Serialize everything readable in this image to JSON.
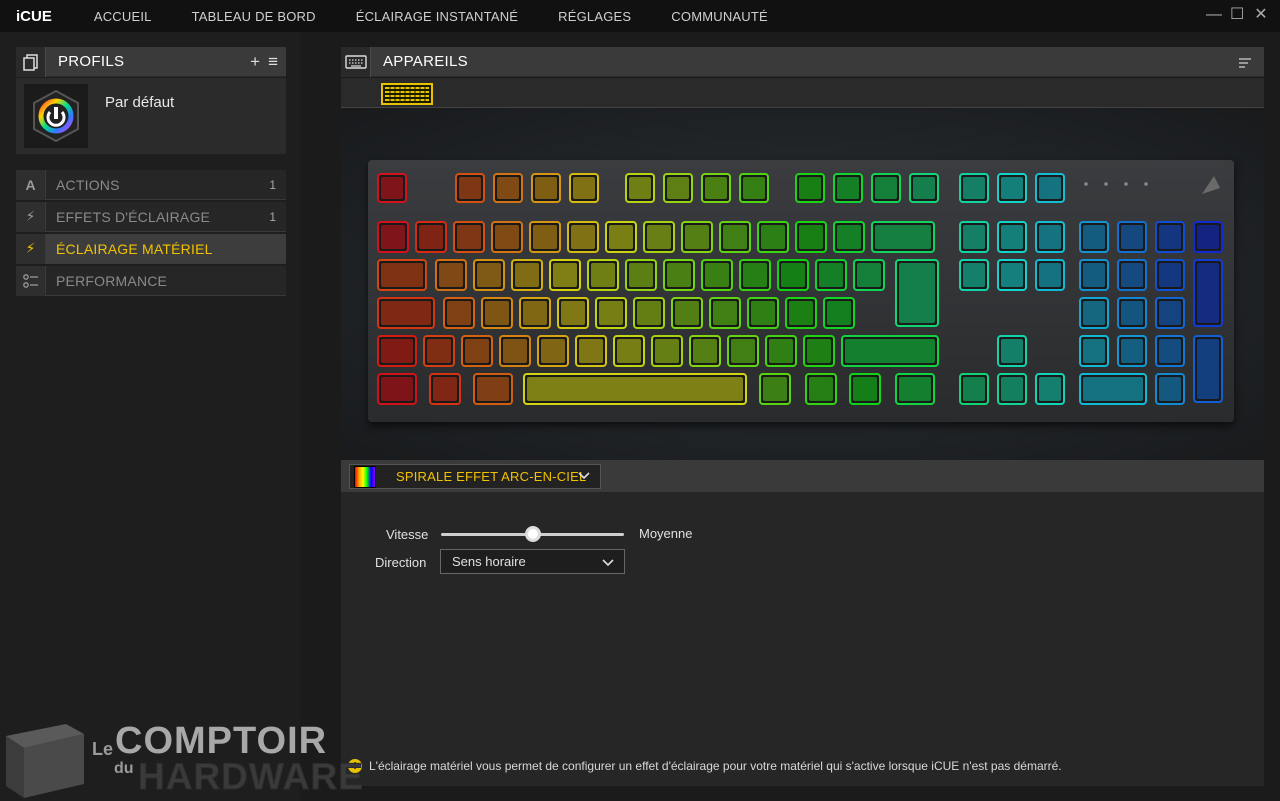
{
  "app": {
    "title": "iCUE"
  },
  "nav": {
    "items": [
      {
        "label": "ACCUEIL"
      },
      {
        "label": "TABLEAU DE BORD"
      },
      {
        "label": "ÉCLAIRAGE INSTANTANÉ"
      },
      {
        "label": "RÉGLAGES"
      },
      {
        "label": "COMMUNAUTÉ"
      }
    ]
  },
  "window_controls": {
    "minimize": "—",
    "maximize": "☐",
    "close": "✕"
  },
  "profiles": {
    "title": "PROFILS",
    "add": "+",
    "menu": "≡",
    "current": {
      "name": "Par défaut"
    }
  },
  "sidebar": {
    "items": [
      {
        "label": "ACTIONS",
        "count": "1",
        "icon": "A",
        "icon_name": "actions-icon"
      },
      {
        "label": "EFFETS D'ÉCLAIRAGE",
        "count": "1",
        "icon": "⚡",
        "icon_name": "lightning-icon"
      },
      {
        "label": "ÉCLAIRAGE MATÉRIEL",
        "count": "",
        "icon": "⚡",
        "icon_name": "lightning-icon"
      },
      {
        "label": "PERFORMANCE",
        "count": "",
        "icon": "⚙",
        "icon_name": "performance-icon"
      }
    ],
    "active_index": 2
  },
  "devices": {
    "title": "APPAREILS"
  },
  "effect": {
    "name": "SPIRALE EFFET ARC-EN-CIEL",
    "caret": "⌄"
  },
  "settings": {
    "speed_label": "Vitesse",
    "speed_value": "Moyenne",
    "speed_fraction": 0.5,
    "direction_label": "Direction",
    "direction_value": "Sens horaire"
  },
  "info": {
    "icon": "!",
    "text": "L'éclairage matériel vous permet de configurer un effet d'éclairage pour votre matériel qui s'active lorsque iCUE n'est pas démarré."
  },
  "watermark": {
    "le": "Le",
    "comptoir": "COMPTOIR",
    "du": "du",
    "hardware": "HARDWARE"
  },
  "colors": {
    "accent": "#f2c200"
  }
}
